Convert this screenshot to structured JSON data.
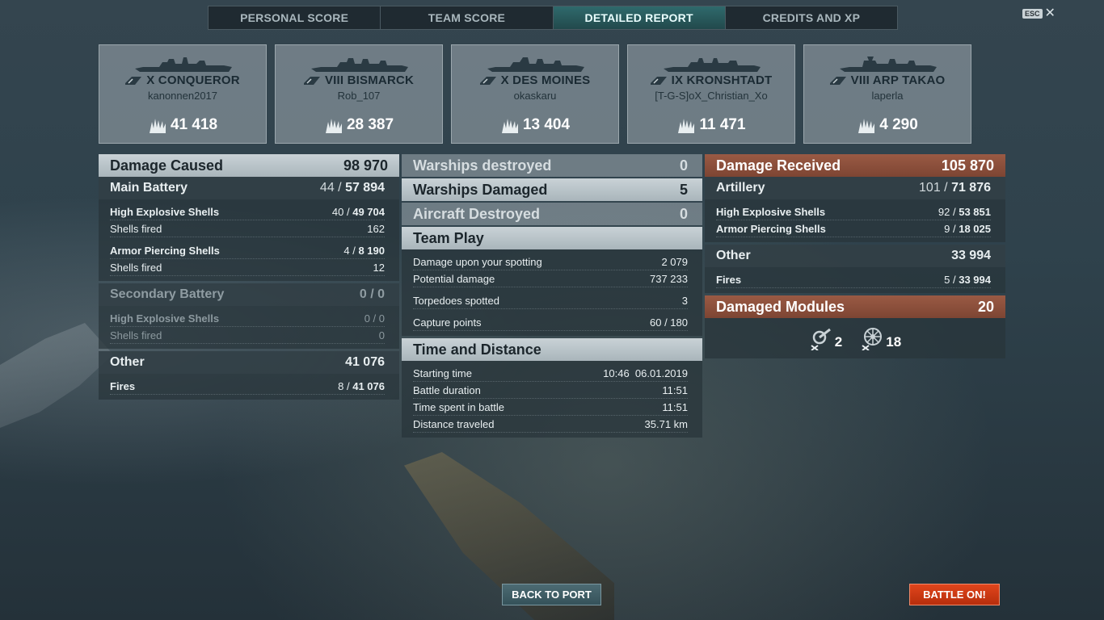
{
  "tabs": [
    {
      "label": "PERSONAL SCORE"
    },
    {
      "label": "TEAM SCORE"
    },
    {
      "label": "DETAILED REPORT"
    },
    {
      "label": "CREDITS AND XP"
    }
  ],
  "esc": {
    "key": "ESC",
    "close": "✕"
  },
  "ships": [
    {
      "name": "X CONQUEROR",
      "player": "kanonnen2017",
      "damage": "41 418"
    },
    {
      "name": "VIII BISMARCK",
      "player": "Rob_107",
      "damage": "28 387"
    },
    {
      "name": "X DES MOINES",
      "player": "okaskaru",
      "damage": "13 404"
    },
    {
      "name": "IX KRONSHTADT",
      "player": "[T-G-S]oX_Christian_Xo",
      "damage": "11 471"
    },
    {
      "name": "VIII ARP TAKAO",
      "player": "laperla",
      "damage": "4 290"
    }
  ],
  "damage_caused": {
    "label": "Damage Caused",
    "value": "98 970",
    "main_battery": {
      "label": "Main Battery",
      "hits": "44",
      "sep": " / ",
      "damage": "57 894",
      "he": {
        "label": "High Explosive Shells",
        "hits": "40",
        "damage": "49 704"
      },
      "he_fired": {
        "label": "Shells fired",
        "value": "162"
      },
      "ap": {
        "label": "Armor Piercing Shells",
        "hits": "4",
        "damage": "8 190"
      },
      "ap_fired": {
        "label": "Shells fired",
        "value": "12"
      }
    },
    "secondary": {
      "label": "Secondary Battery",
      "value": "0 / 0",
      "he": {
        "label": "High Explosive Shells",
        "value": "0 / 0"
      },
      "fired": {
        "label": "Shells fired",
        "value": "0"
      }
    },
    "other": {
      "label": "Other",
      "value": "41 076",
      "fires": {
        "label": "Fires",
        "hits": "8",
        "damage": "41 076"
      }
    }
  },
  "middle": {
    "warships_destroyed": {
      "label": "Warships destroyed",
      "value": "0"
    },
    "warships_damaged": {
      "label": "Warships Damaged",
      "value": "5"
    },
    "aircraft_destroyed": {
      "label": "Aircraft Destroyed",
      "value": "0"
    },
    "team_play": {
      "label": "Team Play",
      "spotting": {
        "label": "Damage upon your spotting",
        "value": "2 079"
      },
      "potential": {
        "label": "Potential damage",
        "value": "737 233"
      },
      "torpedoes": {
        "label": "Torpedoes spotted",
        "value": "3"
      },
      "capture": {
        "label": "Capture points",
        "value": "60 / 180"
      }
    },
    "time_distance": {
      "label": "Time and Distance",
      "start": {
        "label": "Starting time",
        "value": "10:46  06.01.2019"
      },
      "duration": {
        "label": "Battle duration",
        "value": "11:51"
      },
      "spent": {
        "label": "Time spent in battle",
        "value": "11:51"
      },
      "distance": {
        "label": "Distance traveled",
        "value": "35.71 km"
      }
    }
  },
  "damage_received": {
    "label": "Damage Received",
    "value": "105 870",
    "artillery": {
      "label": "Artillery",
      "hits": "101",
      "damage": "71 876",
      "he": {
        "label": "High Explosive Shells",
        "hits": "92",
        "damage": "53 851"
      },
      "ap": {
        "label": "Armor Piercing Shells",
        "hits": "9",
        "damage": "18 025"
      }
    },
    "other": {
      "label": "Other",
      "value": "33 994",
      "fires": {
        "label": "Fires",
        "hits": "5",
        "damage": "33 994"
      }
    },
    "modules": {
      "label": "Damaged Modules",
      "value": "20",
      "items": [
        {
          "icon": "turret-module-icon",
          "count": "2"
        },
        {
          "icon": "steering-gear-module-icon",
          "count": "18"
        }
      ]
    }
  },
  "buttons": {
    "back": "BACK TO PORT",
    "battle": "BATTLE ON!"
  },
  "colors": {
    "accent_tab": "#2f6a6c",
    "received": "#9a5a44",
    "battle": "#e0451c"
  }
}
